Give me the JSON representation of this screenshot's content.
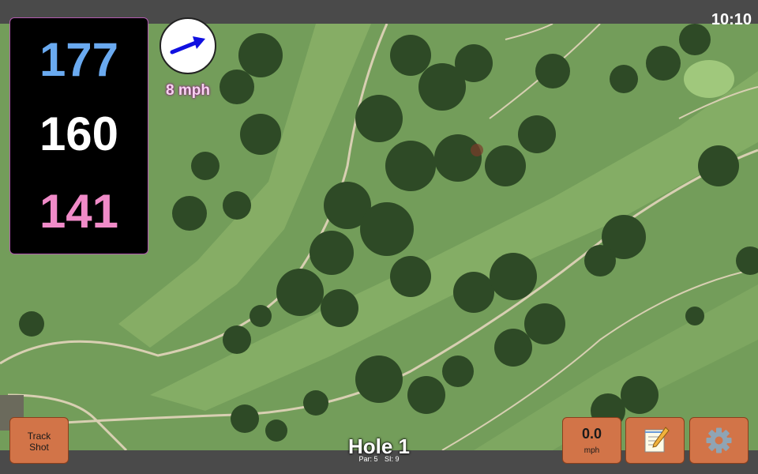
{
  "status": {
    "time": "10:10"
  },
  "distances": {
    "back": "177",
    "middle": "160",
    "front": "141"
  },
  "wind": {
    "speed": "8 mph",
    "icon": "wind-arrow-icon"
  },
  "buttons": {
    "track_shot": {
      "line1": "Track",
      "line2": "Shot"
    },
    "speed": {
      "value": "0.0",
      "unit": "mph"
    },
    "notes": {
      "icon": "notepad-icon"
    },
    "settings": {
      "icon": "gear-icon"
    }
  },
  "hole": {
    "title": "Hole 1",
    "par": "Par: 5",
    "si": "SI: 9"
  },
  "colors": {
    "back_distance": "#6aaaf0",
    "middle_distance": "#ffffff",
    "front_distance": "#f08bc8",
    "button": "#d27448",
    "wind_arrow": "#1010e0"
  }
}
